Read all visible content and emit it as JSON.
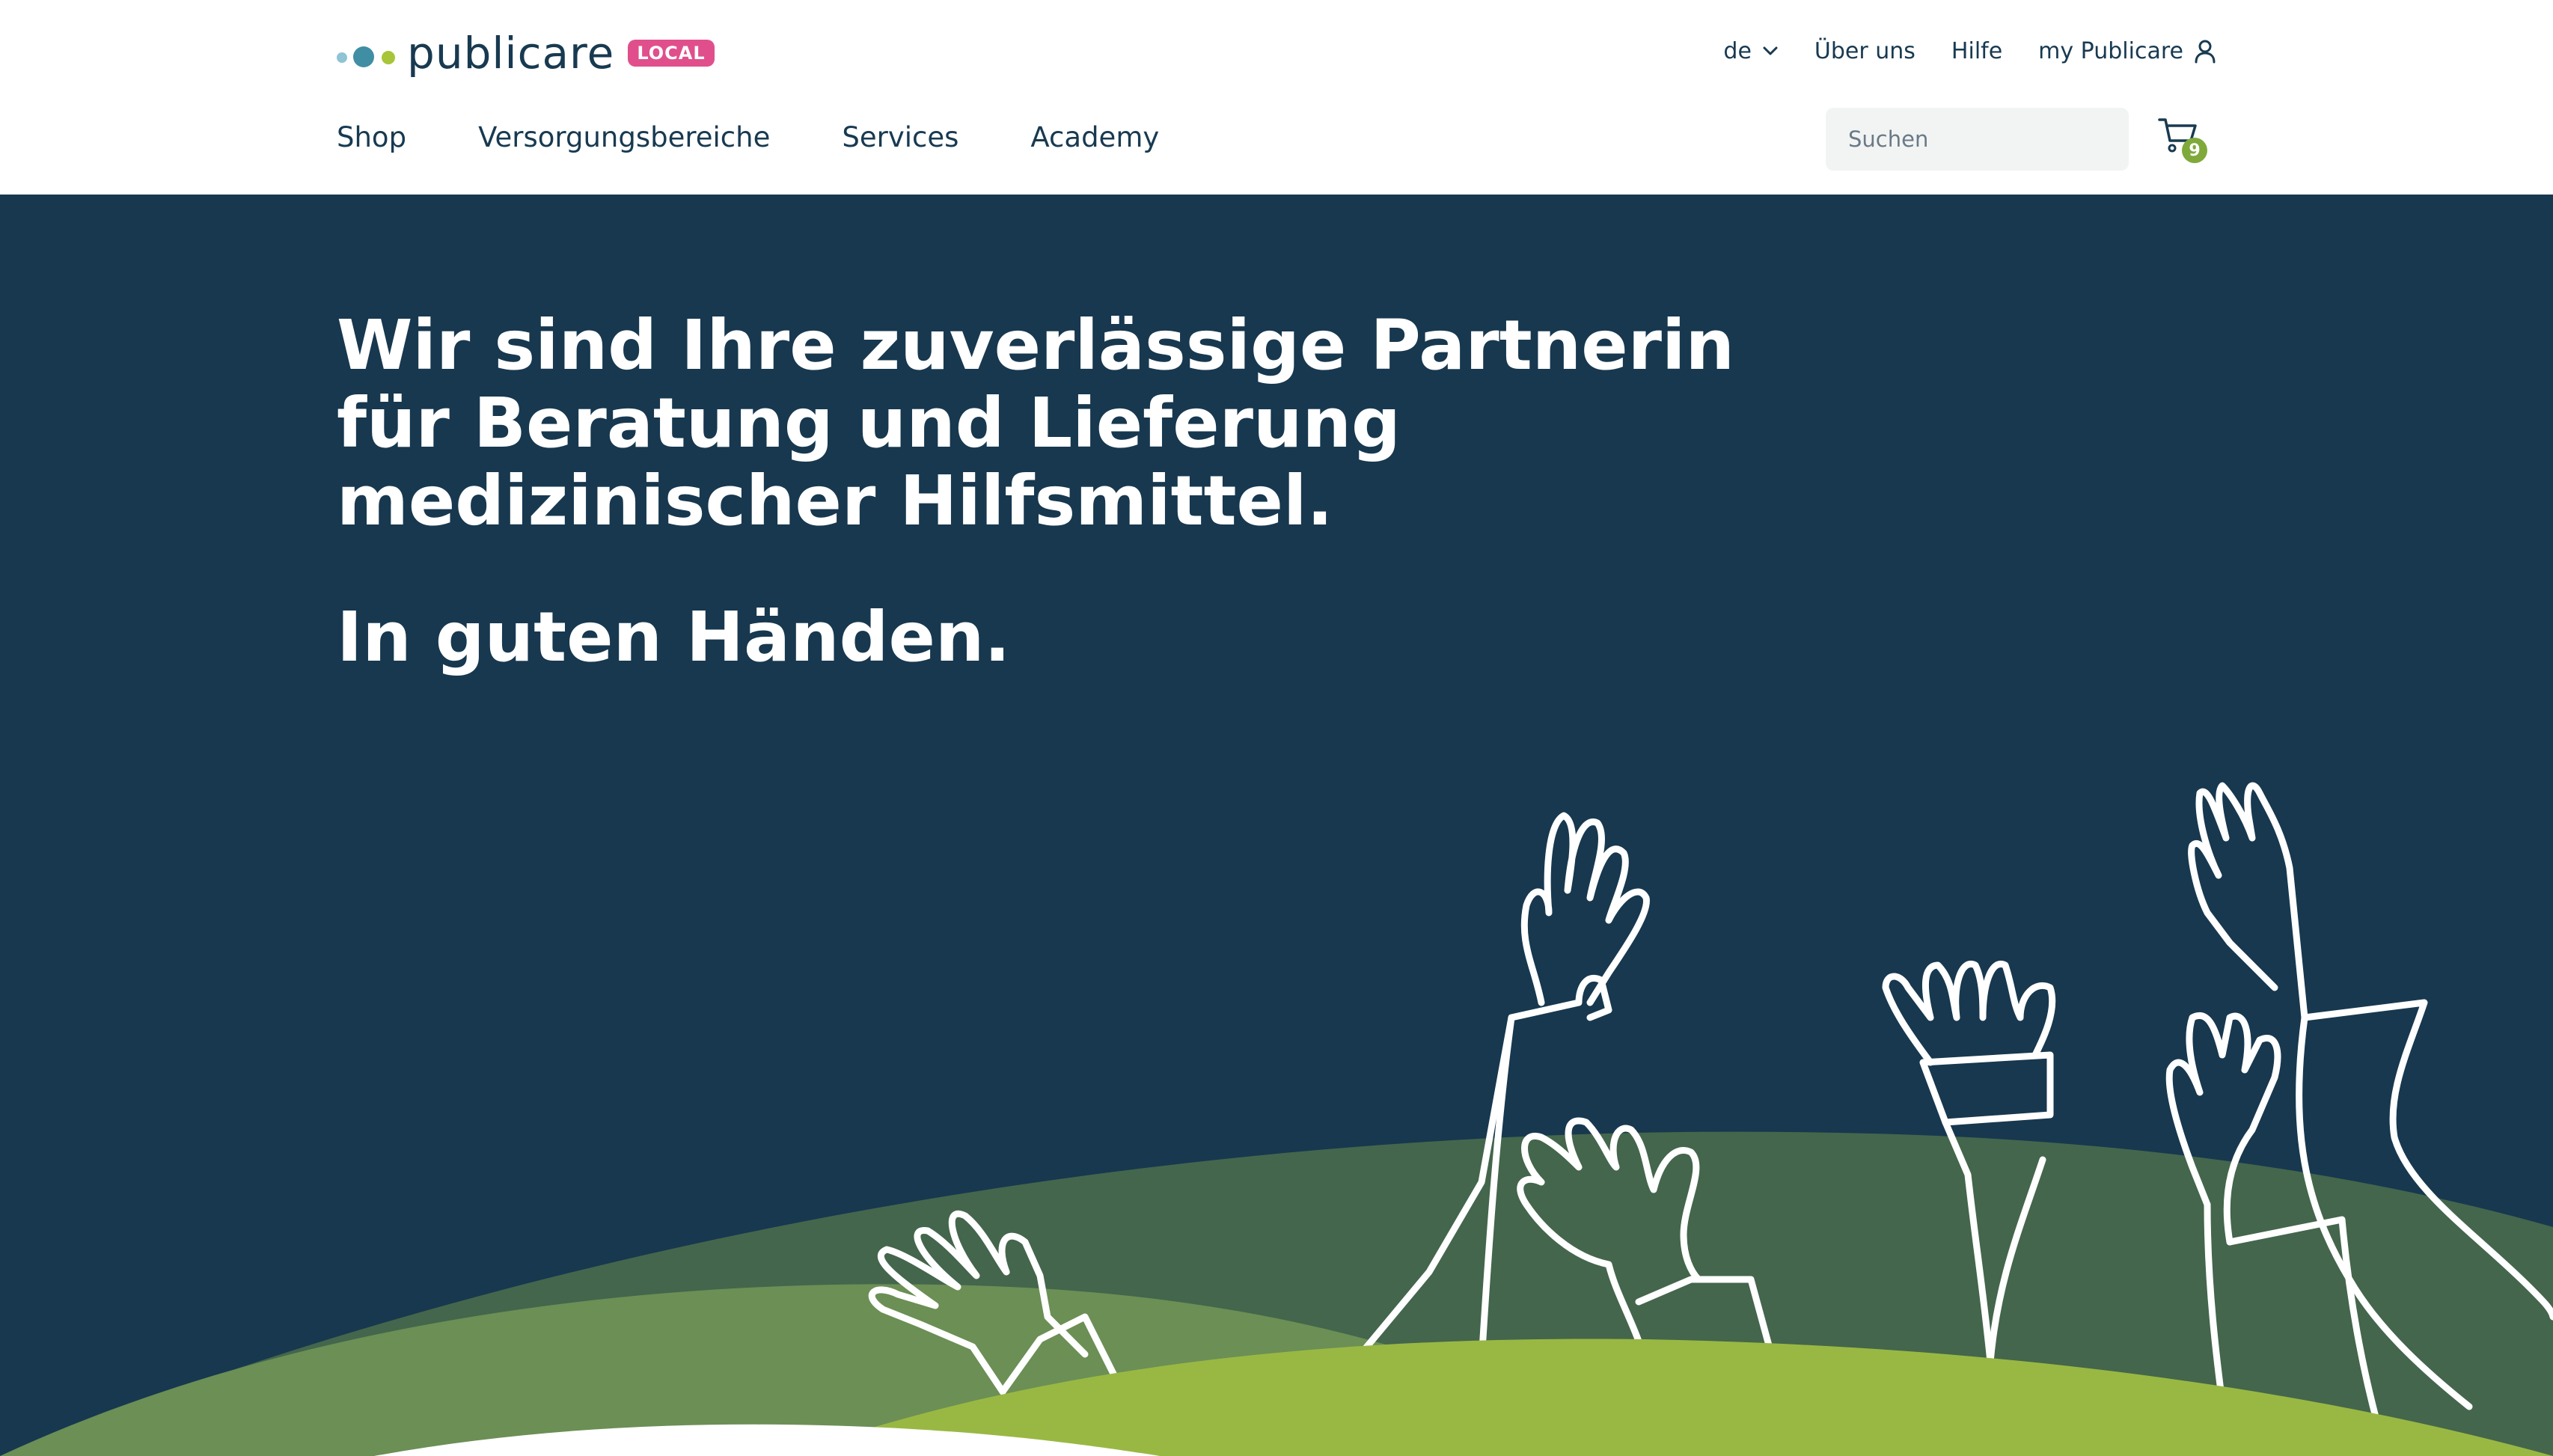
{
  "brand": {
    "name": "publicare",
    "badge": "LOCAL",
    "colors": {
      "navy": "#17384f",
      "text": "#183a51",
      "green": "#a8c539",
      "teal": "#3f8ea4",
      "pink": "#e04f8c"
    }
  },
  "util_nav": {
    "language": "de",
    "about": "Über uns",
    "help": "Hilfe",
    "account": "my Publicare"
  },
  "main_nav": {
    "items": [
      {
        "label": "Shop"
      },
      {
        "label": "Versorgungsbereiche"
      },
      {
        "label": "Services"
      },
      {
        "label": "Academy"
      }
    ]
  },
  "search": {
    "placeholder": "Suchen",
    "value": ""
  },
  "cart": {
    "count": "9"
  },
  "hero": {
    "headline_lines": [
      "Wir sind Ihre zuverlässige Partnerin",
      "für Beratung und Lieferung",
      "medizinischer Hilfsmittel."
    ],
    "tagline": "In guten Händen."
  },
  "icons": {
    "language_toggle": "chevron-down-icon",
    "account": "user-icon",
    "search": "search-icon",
    "cart": "cart-icon"
  }
}
